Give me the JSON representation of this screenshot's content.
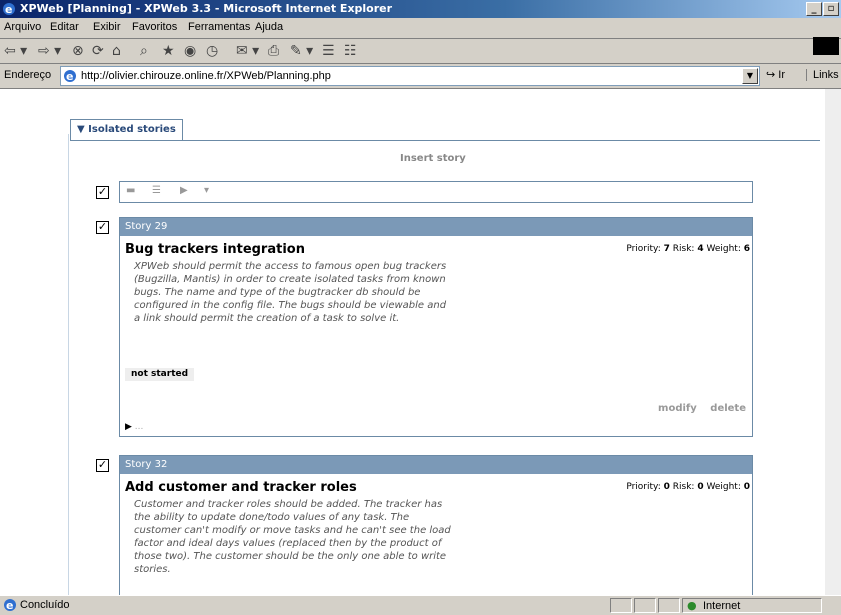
{
  "window": {
    "title": "XPWeb [Planning] - XPWeb 3.3 - Microsoft Internet Explorer"
  },
  "menu": [
    "Arquivo",
    "Editar",
    "Exibir",
    "Favoritos",
    "Ferramentas",
    "Ajuda"
  ],
  "address": {
    "label": "Endereço",
    "url": "http://olivier.chirouze.online.fr/XPWeb/Planning.php",
    "go": "Ir",
    "links": "Links"
  },
  "page": {
    "tab": "▼ Isolated stories",
    "insert": "Insert story",
    "stories": [
      {
        "id": "Story 29",
        "title": "Bug trackers integration",
        "priority_label": "Priority:",
        "priority": "7",
        "risk_label": "Risk:",
        "risk": "4",
        "weight_label": "Weight:",
        "weight": "6",
        "description": "XPWeb should permit the access to famous open bug trackers (Bugzilla, Mantis) in order to create isolated tasks from known bugs. The name and type of the bugtracker db should be configured in the config file. The bugs should be viewable and a link should permit the creation of a task to solve it.",
        "state": "not started",
        "modify": "modify",
        "delete": "delete",
        "expand": "..."
      },
      {
        "id": "Story 32",
        "title": "Add customer and tracker roles",
        "priority_label": "Priority:",
        "priority": "0",
        "risk_label": "Risk:",
        "risk": "0",
        "weight_label": "Weight:",
        "weight": "0",
        "description": "Customer and tracker roles should be added. The tracker has the ability to update done/todo values of any task. The customer can't modify or move tasks and he can't see the load factor and ideal days values (replaced then by the product of those two). The customer should be the only one able to write stories."
      }
    ]
  },
  "status": {
    "text": "Concluído",
    "zone": "Internet"
  },
  "colors": {
    "title_start": "#0a246a",
    "story_header": "#7b99b7",
    "tab_text": "#2a4a7a"
  }
}
